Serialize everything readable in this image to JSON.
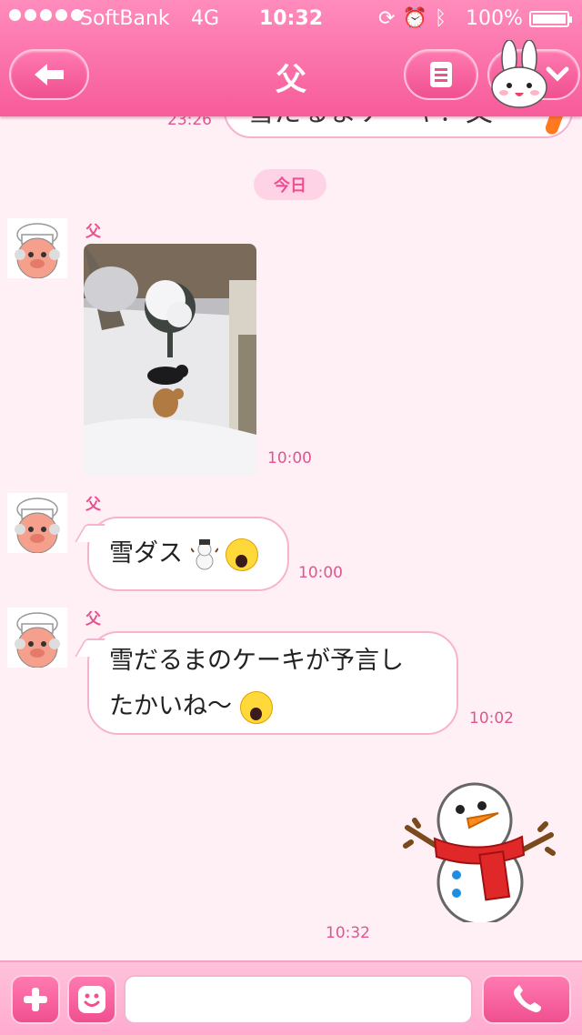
{
  "status_bar": {
    "carrier": "SoftBank",
    "network": "4G",
    "time": "10:32",
    "battery": "100%",
    "icons": [
      "orientation-lock-icon",
      "alarm-icon",
      "bluetooth-icon"
    ]
  },
  "header": {
    "title": "父",
    "back_icon": "back-arrow-icon",
    "menu_icon": "menu-icon",
    "profile_icon": "bunny-avatar-icon",
    "dropdown_icon": "chevron-down-icon"
  },
  "chat": {
    "previous_message": {
      "text": "雪だるまケーキ！父",
      "time": "23:26"
    },
    "date_divider": "今日",
    "messages": [
      {
        "sender": "父",
        "type": "photo",
        "time": "10:00"
      },
      {
        "sender": "父",
        "type": "text",
        "text": "雪ダス",
        "emoji": [
          "snowman",
          "scream-face"
        ],
        "time": "10:00"
      },
      {
        "sender": "父",
        "type": "text",
        "text_line1": "雪だるまのケーキが予言し",
        "text_line2": "たかいね〜",
        "emoji": [
          "scream-face"
        ],
        "time": "10:02"
      },
      {
        "sender": "me",
        "type": "sticker",
        "sticker": "snowman-sticker",
        "time": "10:32"
      }
    ]
  },
  "input_bar": {
    "plus_icon": "plus-icon",
    "emoji_icon": "smiley-icon",
    "placeholder": "",
    "call_icon": "phone-icon"
  },
  "colors": {
    "header_pink": "#f75b9a",
    "background": "#fff0f6",
    "bubble_border": "#f6b3cf",
    "timestamp": "#e0558f"
  }
}
